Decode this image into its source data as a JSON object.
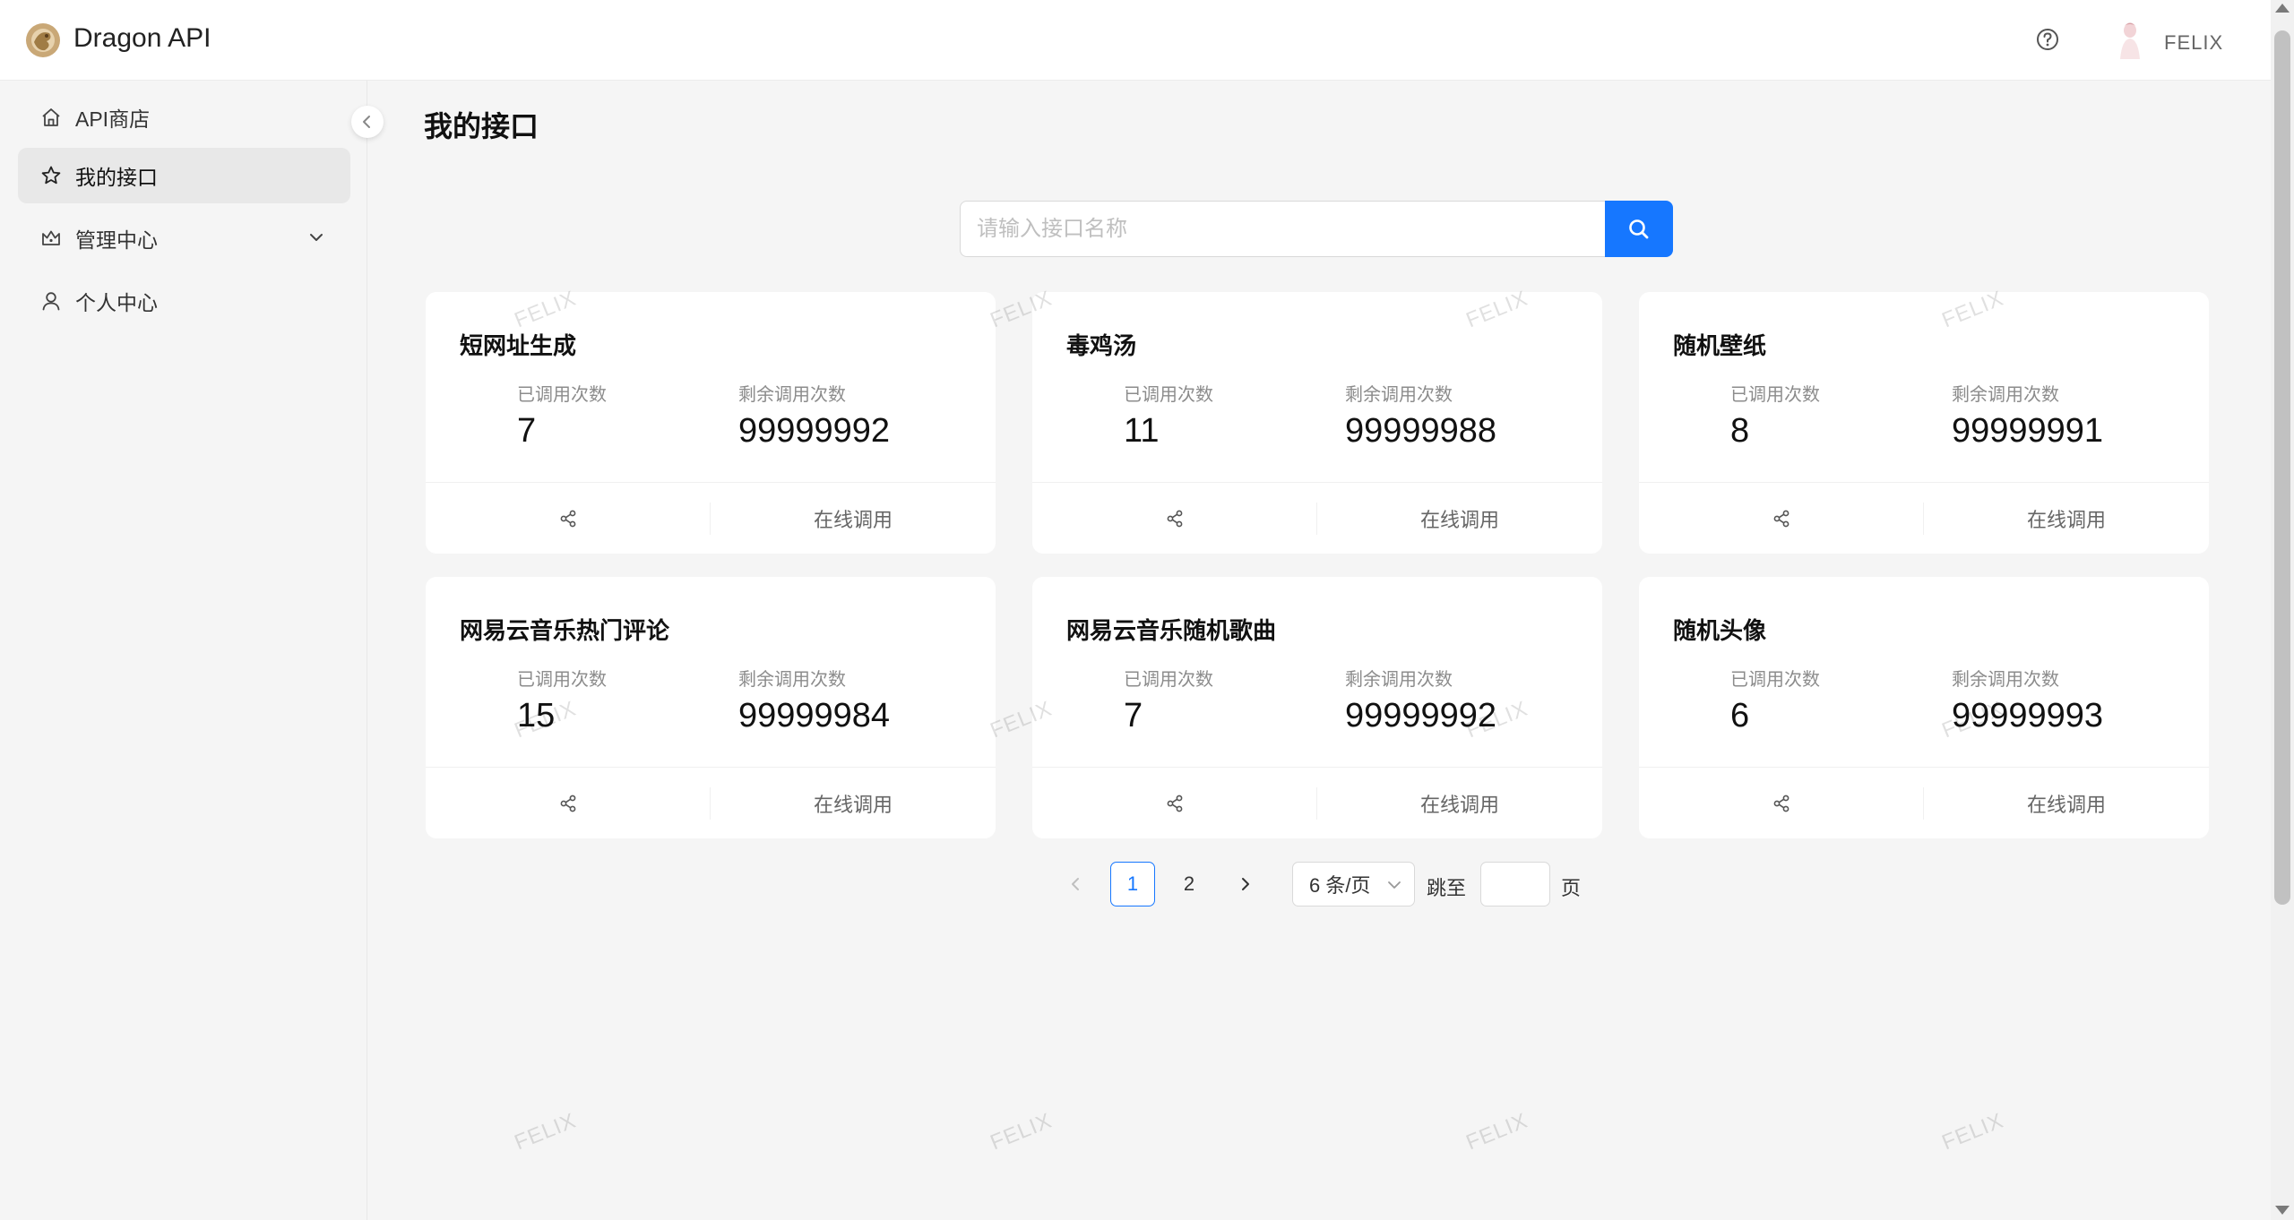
{
  "header": {
    "app_title": "Dragon API",
    "user_name": "FELIX"
  },
  "sidebar": {
    "items": [
      {
        "label": "API商店",
        "icon": "home-icon"
      },
      {
        "label": "我的接口",
        "icon": "star-icon",
        "active": true
      },
      {
        "label": "管理中心",
        "icon": "crown-icon",
        "expandable": true
      },
      {
        "label": "个人中心",
        "icon": "user-icon"
      }
    ]
  },
  "main": {
    "title": "我的接口",
    "search": {
      "placeholder": "请输入接口名称",
      "value": ""
    },
    "card_labels": {
      "used": "已调用次数",
      "remaining": "剩余调用次数",
      "call": "在线调用"
    },
    "cards": [
      {
        "name": "短网址生成",
        "used": "7",
        "remaining": "99999992"
      },
      {
        "name": "毒鸡汤",
        "used": "11",
        "remaining": "99999988"
      },
      {
        "name": "随机壁纸",
        "used": "8",
        "remaining": "99999991"
      },
      {
        "name": "网易云音乐热门评论",
        "used": "15",
        "remaining": "99999984"
      },
      {
        "name": "网易云音乐随机歌曲",
        "used": "7",
        "remaining": "99999992"
      },
      {
        "name": "随机头像",
        "used": "6",
        "remaining": "99999993"
      }
    ],
    "pagination": {
      "pages": [
        "1",
        "2"
      ],
      "current": "1",
      "page_size": "6 条/页",
      "jump_label": "跳至",
      "page_label": "页"
    }
  },
  "watermark": "FELIX",
  "colors": {
    "primary": "#1677ff",
    "background": "#f5f5f5"
  }
}
